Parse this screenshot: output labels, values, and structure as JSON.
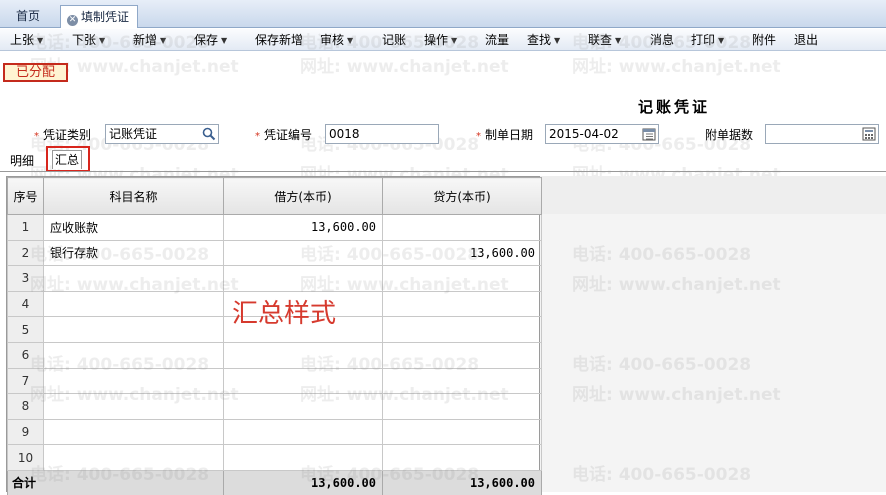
{
  "tabs": {
    "home": "首页",
    "active": "填制凭证"
  },
  "toolbar": {
    "items": [
      "上张",
      "下张",
      "新增",
      "保存",
      "保存新增",
      "审核",
      "记账",
      "操作",
      "流量",
      "查找",
      "联查",
      "消息",
      "打印",
      "附件",
      "退出"
    ]
  },
  "stamp": "已分配",
  "doc_title": "记账凭证",
  "fields": {
    "voucher_type_label": "凭证类别",
    "voucher_type_value": "记账凭证",
    "voucher_no_label": "凭证编号",
    "voucher_no_value": "0018",
    "date_label": "制单日期",
    "date_value": "2015-04-02",
    "attach_label": "附单据数",
    "attach_value": ""
  },
  "subtabs": {
    "detail": "明细",
    "summary": "汇总"
  },
  "grid": {
    "headers": {
      "seq": "序号",
      "account": "科目名称",
      "debit": "借方(本币)",
      "credit": "贷方(本币)"
    },
    "rows": [
      {
        "seq": "1",
        "account": "应收账款",
        "debit": "13,600.00",
        "credit": ""
      },
      {
        "seq": "2",
        "account": "银行存款",
        "debit": "",
        "credit": "13,600.00"
      },
      {
        "seq": "3",
        "account": "",
        "debit": "",
        "credit": ""
      },
      {
        "seq": "4",
        "account": "",
        "debit": "",
        "credit": ""
      },
      {
        "seq": "5",
        "account": "",
        "debit": "",
        "credit": ""
      },
      {
        "seq": "6",
        "account": "",
        "debit": "",
        "credit": ""
      },
      {
        "seq": "7",
        "account": "",
        "debit": "",
        "credit": ""
      },
      {
        "seq": "8",
        "account": "",
        "debit": "",
        "credit": ""
      },
      {
        "seq": "9",
        "account": "",
        "debit": "",
        "credit": ""
      },
      {
        "seq": "10",
        "account": "",
        "debit": "",
        "credit": ""
      }
    ],
    "total": {
      "label": "合计",
      "debit": "13,600.00",
      "credit": "13,600.00"
    }
  },
  "annotation": "汇总样式",
  "watermark": {
    "phone": "电话: 400-665-0028",
    "site": "网址: www.chanjet.net"
  },
  "colors": {
    "accent_red": "#d8261d",
    "stamp_bg": "#fff4d2"
  }
}
